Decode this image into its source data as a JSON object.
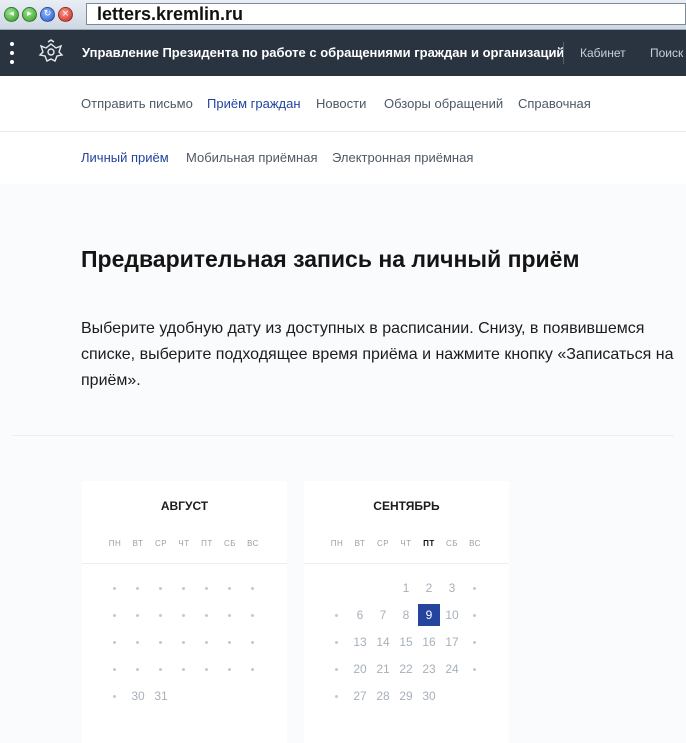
{
  "browser": {
    "url": "letters.kremlin.ru"
  },
  "header": {
    "org_name": "Управление Президента по работе с обращениями граждан и организаций",
    "cabinet": "Кабинет",
    "search": "Поиск"
  },
  "main_nav": [
    "Отправить письмо",
    "Приём граждан",
    "Новости",
    "Обзоры обращений",
    "Справочная"
  ],
  "main_nav_active": "Приём граждан",
  "sub_nav": [
    "Личный приём",
    "Мобильная приёмная",
    "Электронная приёмная"
  ],
  "sub_nav_active": "Личный приём",
  "page": {
    "title": "Предварительная запись на личный приём",
    "intro": "Выберите удобную дату из доступных в расписании. Снизу, в появившемся списке, выберите подходящее время приёма и нажмите кнопку «Записаться на приём»."
  },
  "weekdays": [
    "ПН",
    "ВТ",
    "СР",
    "ЧТ",
    "ПТ",
    "СБ",
    "ВС"
  ],
  "calendars": [
    {
      "month": "АВГУСТ",
      "highlight_weekday": null,
      "weeks": [
        [
          "•",
          "•",
          "•",
          "•",
          "•",
          "•",
          "•"
        ],
        [
          "•",
          "•",
          "•",
          "•",
          "•",
          "•",
          "•"
        ],
        [
          "•",
          "•",
          "•",
          "•",
          "•",
          "•",
          "•"
        ],
        [
          "•",
          "•",
          "•",
          "•",
          "•",
          "•",
          "•"
        ],
        [
          "•",
          "30",
          "31",
          "",
          "",
          "",
          ""
        ]
      ]
    },
    {
      "month": "СЕНТЯБРЬ",
      "highlight_weekday": "ПТ",
      "selected": "9",
      "weeks": [
        [
          "",
          "",
          "",
          "1",
          "2",
          "3",
          "•"
        ],
        [
          "•",
          "6",
          "7",
          "8",
          "9",
          "10",
          "•"
        ],
        [
          "•",
          "13",
          "14",
          "15",
          "16",
          "17",
          "•"
        ],
        [
          "•",
          "20",
          "21",
          "22",
          "23",
          "24",
          "•"
        ],
        [
          "•",
          "27",
          "28",
          "29",
          "30",
          "",
          ""
        ]
      ]
    }
  ],
  "colors": {
    "header_bg": "#2a3441",
    "accent": "#24449e"
  }
}
